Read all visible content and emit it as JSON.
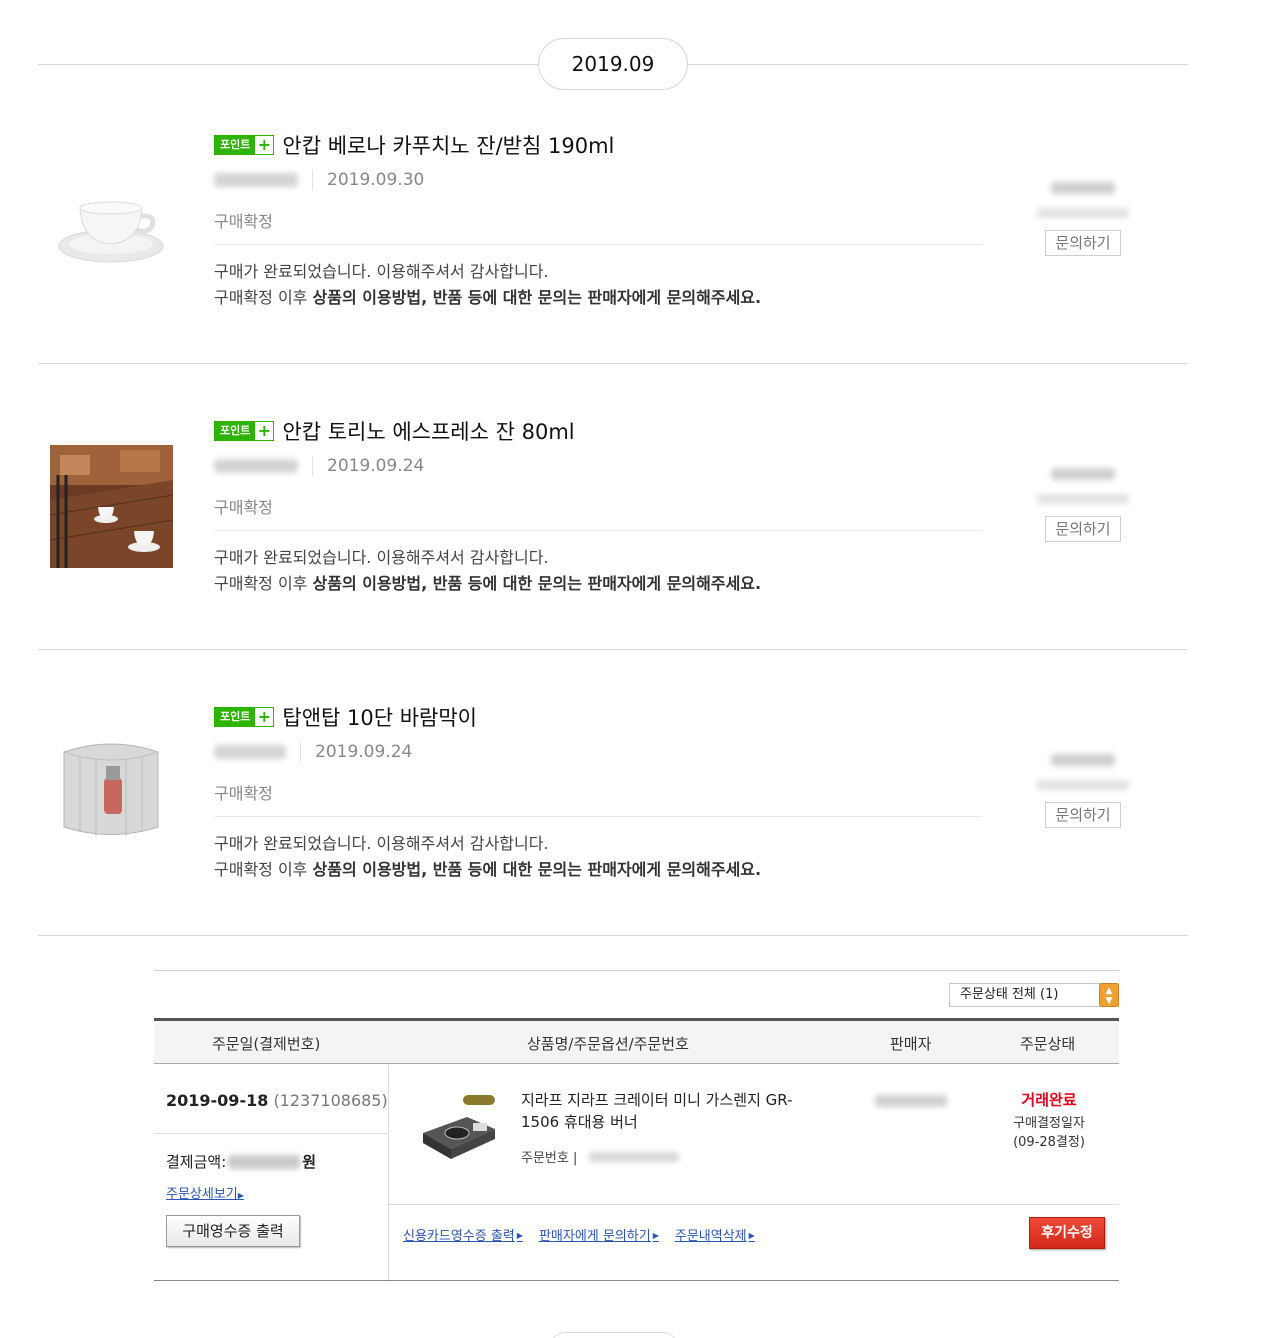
{
  "month": "2019.09",
  "badge": {
    "label": "포인트",
    "plus": "+"
  },
  "items": [
    {
      "title": "안캅 베로나 카푸치노 잔/받침 190ml",
      "date": "2019.09.30",
      "status": "구매확정",
      "message_line1": "구매가 완료되었습니다. 이용해주셔서 감사합니다.",
      "message_prefix": "구매확정 이후 ",
      "message_bold": "상품의 이용방법, 반품 등에 대한 문의는 판매자에게 문의해주세요.",
      "ask_label": "문의하기",
      "image_icon": "cappuccino-cup-icon"
    },
    {
      "title": "안캅 토리노 에스프레소 잔 80ml",
      "date": "2019.09.24",
      "status": "구매확정",
      "message_line1": "구매가 완료되었습니다. 이용해주셔서 감사합니다.",
      "message_prefix": "구매확정 이후 ",
      "message_bold": "상품의 이용방법, 반품 등에 대한 문의는 판매자에게 문의해주세요.",
      "ask_label": "문의하기",
      "image_icon": "espresso-cups-photo"
    },
    {
      "title": "탑앤탑 10단 바람막이",
      "date": "2019.09.24",
      "status": "구매확정",
      "message_line1": "구매가 완료되었습니다. 이용해주셔서 감사합니다.",
      "message_prefix": "구매확정 이후 ",
      "message_bold": "상품의 이용방법, 반품 등에 대한 문의는 판매자에게 문의해주세요.",
      "ask_label": "문의하기",
      "image_icon": "windscreen-icon"
    }
  ],
  "order_table": {
    "filter_label": "주문상태 전체 (1)",
    "headers": {
      "date": "주문일(결제번호)",
      "product": "상품명/주문옵션/주문번호",
      "seller": "판매자",
      "state": "주문상태"
    },
    "order": {
      "date": "2019-09-18",
      "payment_no": "(1237108685)",
      "pay_label": "결제금액:",
      "pay_unit": "원",
      "detail_link": "주문상세보기",
      "receipt_button": "구매영수증 출력",
      "product_name": "지라프 지라프 크레이터 미니 가스렌지 GR-1506 휴대용 버너",
      "order_no_label": "주문번호 |",
      "state": "거래완료",
      "confirm_label": "구매결정일자",
      "confirm_date": "(09-28결정)",
      "links": [
        "신용카드영수증 출력",
        "판매자에게 문의하기",
        "주문내역삭제"
      ],
      "review_button": "후기수정"
    }
  },
  "colors": {
    "badge_green": "#2db400",
    "state_red": "#e8001c",
    "link_blue": "#2a55b5",
    "review_red": "#d0281a"
  }
}
